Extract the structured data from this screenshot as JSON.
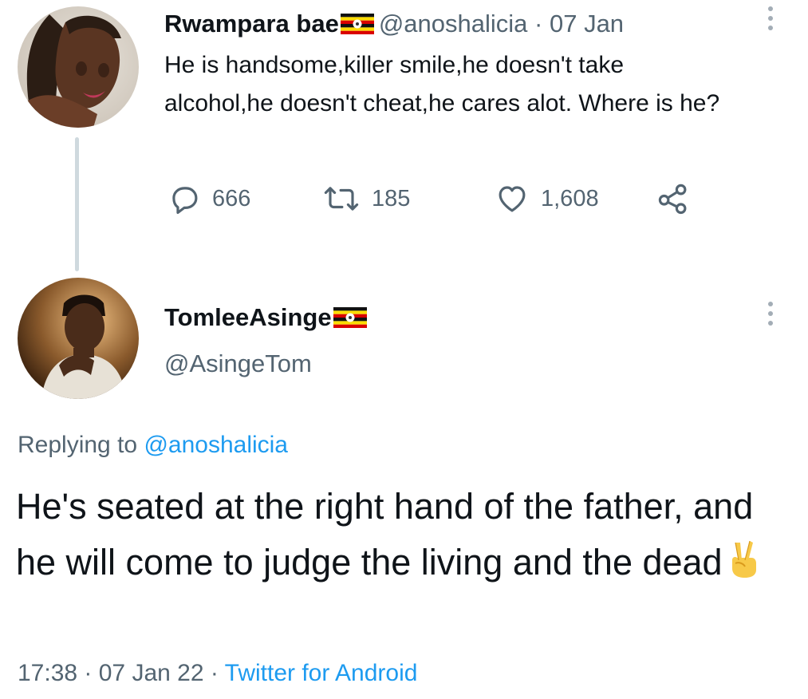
{
  "tweet1": {
    "name": "Rwampara bae",
    "handle": "@anoshalicia",
    "date_sep": " · ",
    "date": "07 Jan",
    "text": "He is handsome,killer smile,he doesn't take alcohol,he doesn't cheat,he cares alot. Where is he?",
    "replies": "666",
    "retweets": "185",
    "likes": "1,608"
  },
  "tweet2": {
    "name": "TomleeAsinge",
    "handle": "@AsingeTom",
    "replying_prefix": "Replying to ",
    "replying_to": "@anoshalicia",
    "text": "He's seated at the right hand of the father, and he will come to judge the living and the dead",
    "time": "17:38",
    "sep1": " · ",
    "date": "07 Jan 22",
    "sep2": " · ",
    "source": "Twitter for Android"
  },
  "icons": {
    "reply": "reply-icon",
    "retweet": "retweet-icon",
    "like": "heart-icon",
    "share": "share-icon",
    "more": "more-vertical-icon",
    "flag": "uganda-flag-icon",
    "emoji": "victory-hand-emoji"
  },
  "colors": {
    "text": "#0f1419",
    "secondary": "#536471",
    "link": "#1d9bf0",
    "thread_line": "#cfd9de"
  }
}
